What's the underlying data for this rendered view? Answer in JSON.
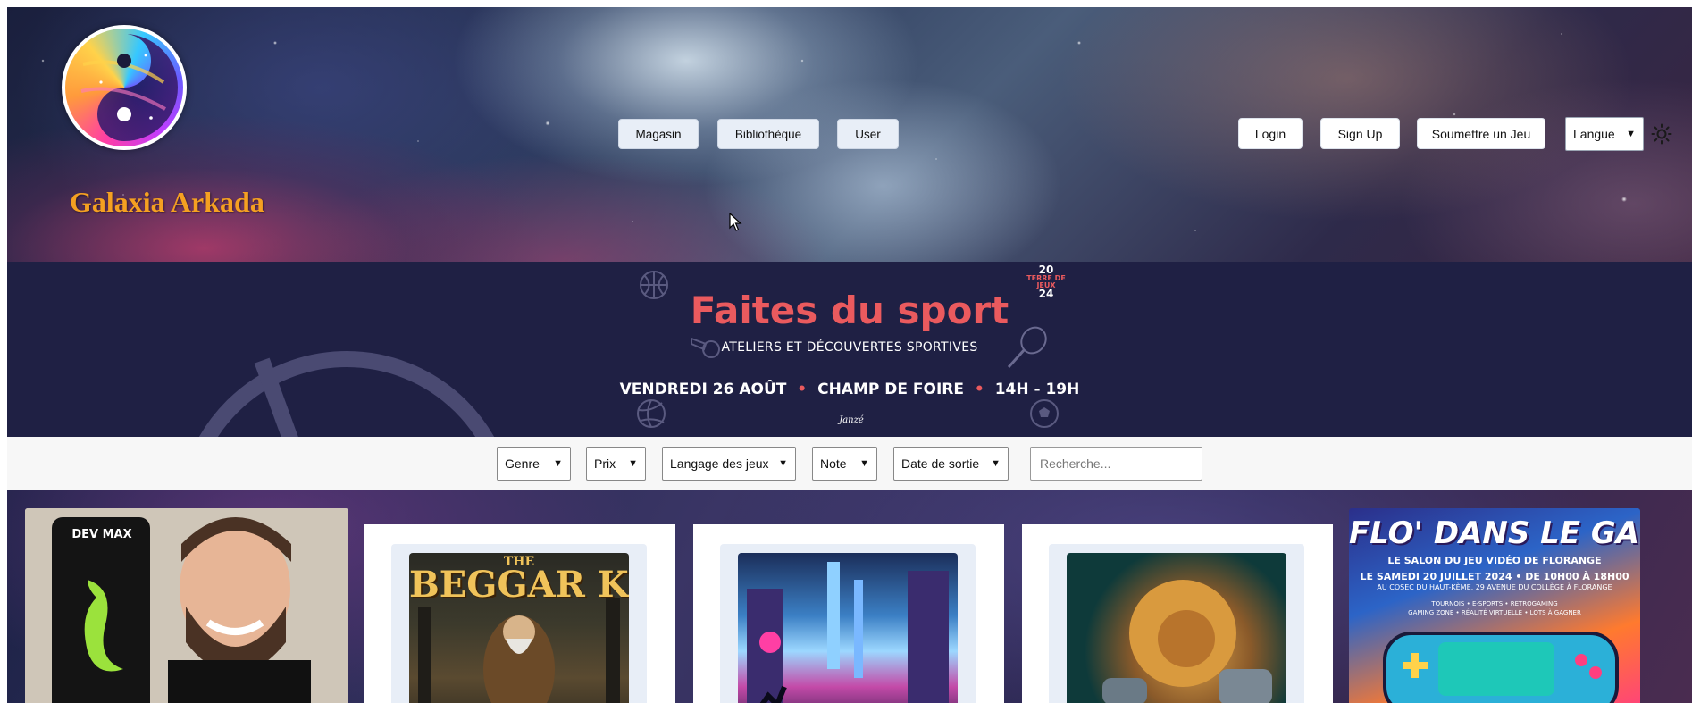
{
  "header": {
    "site_title": "Galaxia Arkada",
    "nav": [
      {
        "label": "Magasin"
      },
      {
        "label": "Bibliothèque"
      },
      {
        "label": "User"
      }
    ],
    "auth": [
      {
        "label": "Login"
      },
      {
        "label": "Sign Up"
      },
      {
        "label": "Soumettre un Jeu"
      }
    ],
    "language_select": {
      "value": "Langue"
    }
  },
  "banner": {
    "title": "Faites du sport",
    "subtitle": "ATELIERS ET DÉCOUVERTES SPORTIVES",
    "date": "VENDREDI 26 AOÛT",
    "place": "CHAMP DE FOIRE",
    "time": "14H - 19H",
    "separator": "•",
    "badge_top": "20",
    "badge_mid": "TERRE DE JEUX",
    "badge_bottom": "24",
    "sponsor": "Janzé"
  },
  "filters": {
    "selects": [
      {
        "label": "Genre"
      },
      {
        "label": "Prix"
      },
      {
        "label": "Langage des jeux"
      },
      {
        "label": "Note"
      },
      {
        "label": "Date de sortie"
      }
    ],
    "search_placeholder": "Recherche..."
  },
  "ads": {
    "left": {
      "can_text": "DEV MAX"
    },
    "right": {
      "title": "FLO' DANS LE GAME",
      "subtitle": "LE SALON DU JEU VIDÉO DE FLORANGE",
      "date": "LE SAMEDI 20 JUILLET 2024 • DE 10H00 À 18H00",
      "address": "AU COSEC DU HAUT-KÈME, 29 AVENUE DU COLLÈGE À FLORANGE",
      "tags_line1": "TOURNOIS • E-SPORTS • RETROGAMING",
      "tags_line2": "GAMING ZONE • RÉALITÉ VIRTUELLE • LOTS À GAGNER"
    }
  },
  "games": [
    {
      "cover_the": "THE",
      "cover_title": "BEGGAR KING"
    },
    {
      "cover_title": ""
    },
    {
      "cover_title": ""
    }
  ],
  "colors": {
    "title_orange": "#f5a021",
    "banner_navy": "#1f2044",
    "banner_red": "#ea5a5e",
    "nav_button_bg": "#e8eef7"
  }
}
